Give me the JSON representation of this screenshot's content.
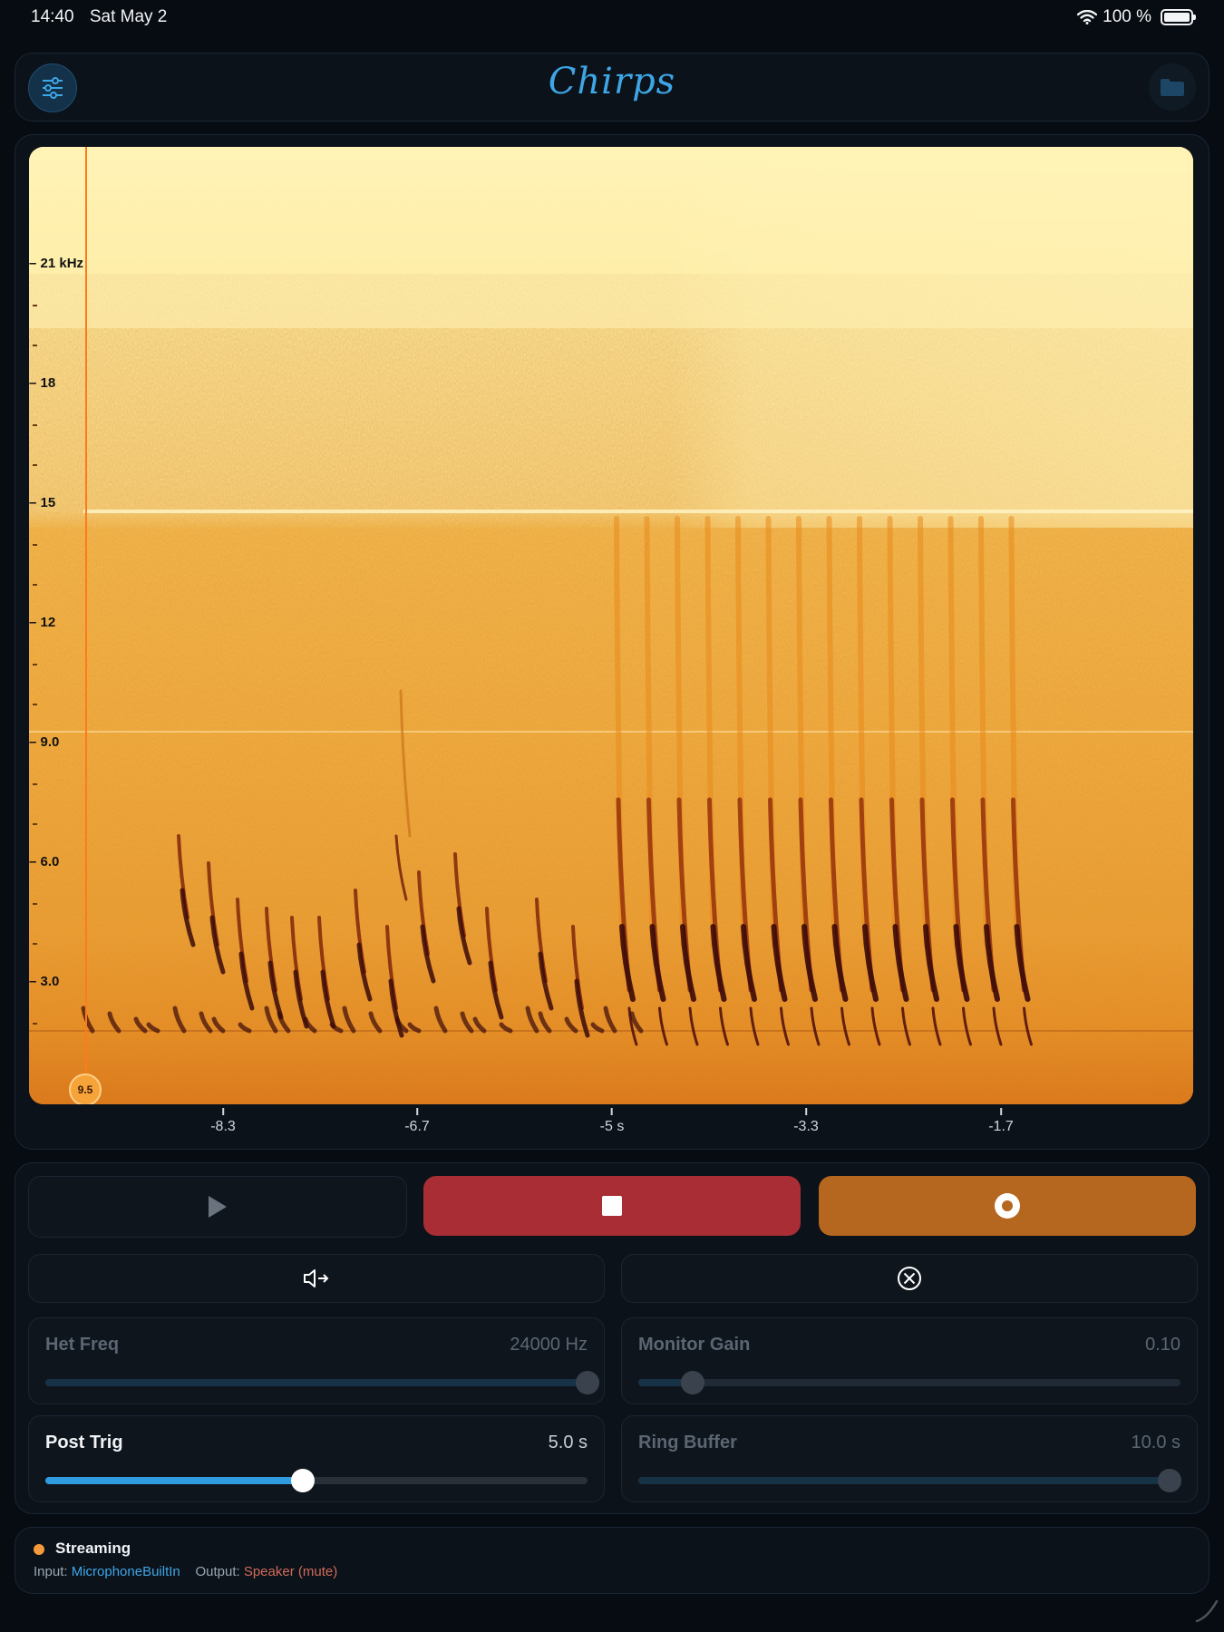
{
  "status_bar": {
    "time": "14:40",
    "date": "Sat May 2",
    "battery": "100 %"
  },
  "header": {
    "title": "Chirps",
    "left_icon": "sliders-icon",
    "right_icon": "folder-icon"
  },
  "spectrogram": {
    "y_ticks": [
      "21 kHz",
      "18",
      "15",
      "12",
      "9.0",
      "6.0",
      "3.0"
    ],
    "x_ticks": [
      "-8.3",
      "-6.7",
      "-5 s",
      "-3.3",
      "-1.7"
    ],
    "marker_label": "9.5",
    "colors": {
      "high": "#fff2b0",
      "mid": "#f3a42a",
      "low": "#3b0a0a",
      "cursor": "#ff7a1a"
    }
  },
  "transport": {
    "play_icon": "play-icon",
    "stop_icon": "stop-icon",
    "record_icon": "record-icon",
    "monitor_icon": "speaker-out-icon",
    "clear_icon": "clear-circle-icon",
    "colors": {
      "stop": "#a92d35",
      "record": "#b5671f",
      "accent": "#2f9be0"
    }
  },
  "sliders": {
    "het_freq": {
      "label": "Het Freq",
      "value": "24000 Hz",
      "fraction": 1.0,
      "enabled": false
    },
    "monitor_gain": {
      "label": "Monitor Gain",
      "value": "0.10",
      "fraction": 0.1,
      "enabled": false
    },
    "post_trig": {
      "label": "Post Trig",
      "value": "5.0 s",
      "fraction": 0.475,
      "enabled": true
    },
    "ring_buffer": {
      "label": "Ring Buffer",
      "value": "10.0 s",
      "fraction": 0.98,
      "enabled": false
    }
  },
  "footer": {
    "state": "Streaming",
    "input_label": "Input:",
    "input_value": "MicrophoneBuiltIn",
    "output_label": "Output:",
    "output_value": "Speaker (mute)",
    "dot_color": "#f59a3a"
  }
}
